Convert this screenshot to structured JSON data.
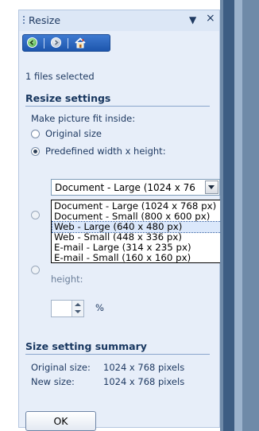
{
  "pane": {
    "title": "Resize",
    "dropdown_glyph": "▼",
    "close_glyph": "×"
  },
  "toolbar": {
    "back_icon": "back-arrow-icon",
    "forward_icon": "forward-arrow-icon",
    "home_icon": "home-icon"
  },
  "status": {
    "files_selected": "1 files selected"
  },
  "resize_settings": {
    "heading": "Resize settings",
    "fit_label": "Make picture fit inside:",
    "options": {
      "original": "Original size",
      "predefined": "Predefined width x height:"
    },
    "hidden_height_label": "height:",
    "percent_symbol": "%"
  },
  "select": {
    "current": "Document - Large (1024 x 76",
    "options": [
      "Document - Large (1024 x 768 px)",
      "Document - Small (800 x 600 px)",
      "Web - Large (640 x 480 px)",
      "Web - Small (448 x 336 px)",
      "E-mail - Large (314 x 235 px)",
      "E-mail - Small (160 x 160 px)"
    ],
    "highlighted_index": 2
  },
  "summary": {
    "heading": "Size setting summary",
    "original_label": "Original size:",
    "original_value": "1024 x 768 pixels",
    "new_label": "New size:",
    "new_value": "1024 x 768 pixels"
  },
  "buttons": {
    "ok": "OK"
  },
  "colors": {
    "pane_bg": "#e7eef9",
    "toolbar_blue": "#2a63bb",
    "heading_text": "#17365f",
    "selection": "#dbe8fb"
  }
}
